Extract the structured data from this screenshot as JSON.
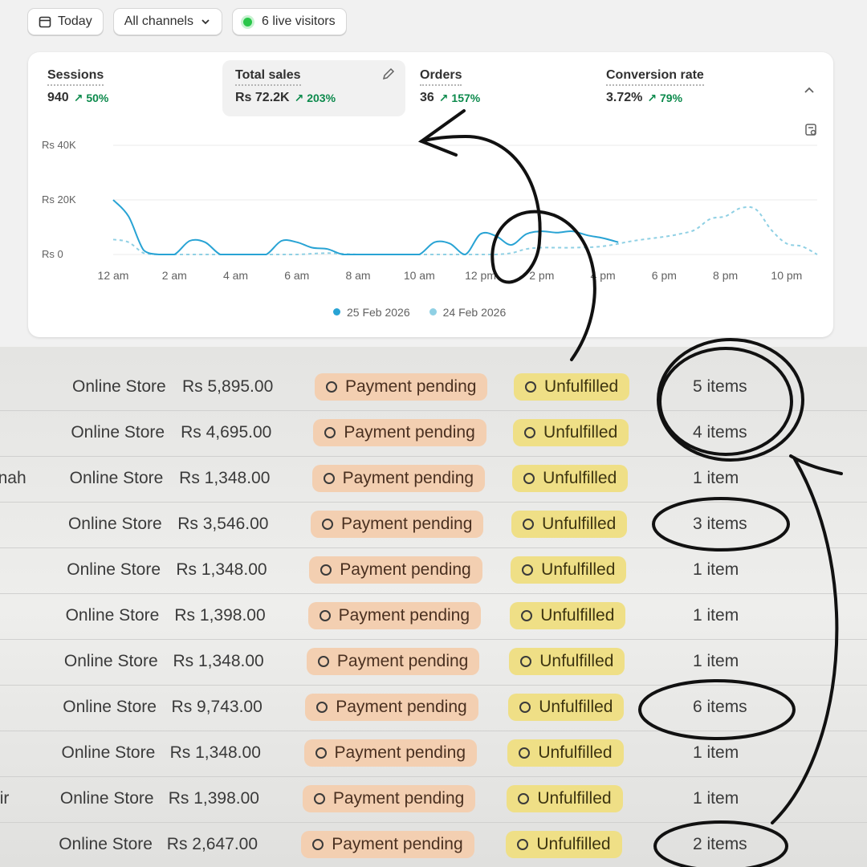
{
  "toolbar": {
    "today_label": "Today",
    "channels_label": "All channels",
    "live_label": "6 live visitors"
  },
  "metrics": [
    {
      "label": "Sessions",
      "value": "940",
      "change": "50%"
    },
    {
      "label": "Total sales",
      "value": "Rs 72.2K",
      "change": "203%"
    },
    {
      "label": "Orders",
      "value": "36",
      "change": "157%"
    },
    {
      "label": "Conversion rate",
      "value": "3.72%",
      "change": "79%"
    }
  ],
  "chart_data": {
    "type": "line",
    "y_ticks": [
      "Rs 40K",
      "Rs 20K",
      "Rs 0"
    ],
    "ylim": [
      0,
      40000
    ],
    "x_ticks": [
      "12 am",
      "2 am",
      "4 am",
      "6 am",
      "8 am",
      "10 am",
      "12 pm",
      "2 pm",
      "4 pm",
      "6 pm",
      "8 pm",
      "10 pm"
    ],
    "series": [
      {
        "name": "25 Feb 2026",
        "color": "#28a3d4",
        "dashed": false,
        "x": [
          0,
          0.5,
          1,
          1.5,
          2,
          2.5,
          3,
          3.5,
          4,
          4.5,
          5,
          5.5,
          6,
          6.5,
          7,
          7.5,
          8,
          8.5,
          9,
          9.5,
          10,
          10.5,
          11,
          11.5,
          12,
          12.5,
          13,
          13.5,
          14,
          14.5,
          15,
          15.5,
          16,
          16.5
        ],
        "y": [
          20000,
          14000,
          1500,
          0,
          0,
          5000,
          4500,
          0,
          0,
          0,
          0,
          5000,
          4500,
          2500,
          2000,
          0,
          0,
          0,
          0,
          0,
          0,
          4500,
          4000,
          0,
          7500,
          6800,
          3500,
          7500,
          8500,
          8000,
          8500,
          7000,
          6000,
          4500
        ]
      },
      {
        "name": "24 Feb 2026",
        "color": "#8fd0e4",
        "dashed": true,
        "x": [
          0,
          0.5,
          1,
          1.5,
          2,
          3,
          4,
          5,
          6,
          7,
          8,
          9,
          10,
          11,
          12,
          12.5,
          13,
          13.5,
          14,
          15,
          16,
          17,
          18,
          18.5,
          19,
          19.5,
          20,
          20.5,
          21,
          21.5,
          22,
          22.5,
          23
        ],
        "y": [
          5500,
          4500,
          500,
          0,
          0,
          0,
          0,
          0,
          0,
          500,
          0,
          0,
          0,
          0,
          0,
          0,
          500,
          2000,
          2500,
          2500,
          3000,
          5000,
          6500,
          7500,
          9000,
          13000,
          14000,
          17000,
          16500,
          9000,
          4000,
          3000,
          0
        ]
      }
    ]
  },
  "legend": [
    "25 Feb 2026",
    "24 Feb 2026"
  ],
  "orders": [
    {
      "customer": "",
      "channel": "Online Store",
      "total": "Rs 5,895.00",
      "payment": "Payment pending",
      "fulfillment": "Unfulfilled",
      "items": "5 items"
    },
    {
      "customer": "",
      "channel": "Online Store",
      "total": "Rs 4,695.00",
      "payment": "Payment pending",
      "fulfillment": "Unfulfilled",
      "items": "4 items"
    },
    {
      "customer": "nah",
      "channel": "Online Store",
      "total": "Rs 1,348.00",
      "payment": "Payment pending",
      "fulfillment": "Unfulfilled",
      "items": "1 item"
    },
    {
      "customer": "",
      "channel": "Online Store",
      "total": "Rs 3,546.00",
      "payment": "Payment pending",
      "fulfillment": "Unfulfilled",
      "items": "3 items"
    },
    {
      "customer": "",
      "channel": "Online Store",
      "total": "Rs 1,348.00",
      "payment": "Payment pending",
      "fulfillment": "Unfulfilled",
      "items": "1 item"
    },
    {
      "customer": "",
      "channel": "Online Store",
      "total": "Rs 1,398.00",
      "payment": "Payment pending",
      "fulfillment": "Unfulfilled",
      "items": "1 item"
    },
    {
      "customer": "",
      "channel": "Online Store",
      "total": "Rs 1,348.00",
      "payment": "Payment pending",
      "fulfillment": "Unfulfilled",
      "items": "1 item"
    },
    {
      "customer": "",
      "channel": "Online Store",
      "total": "Rs 9,743.00",
      "payment": "Payment pending",
      "fulfillment": "Unfulfilled",
      "items": "6 items"
    },
    {
      "customer": "",
      "channel": "Online Store",
      "total": "Rs 1,348.00",
      "payment": "Payment pending",
      "fulfillment": "Unfulfilled",
      "items": "1 item"
    },
    {
      "customer": "sir",
      "channel": "Online Store",
      "total": "Rs 1,398.00",
      "payment": "Payment pending",
      "fulfillment": "Unfulfilled",
      "items": "1 item"
    },
    {
      "customer": "",
      "channel": "Online Store",
      "total": "Rs 2,647.00",
      "payment": "Payment pending",
      "fulfillment": "Unfulfilled",
      "items": "2 items"
    }
  ]
}
